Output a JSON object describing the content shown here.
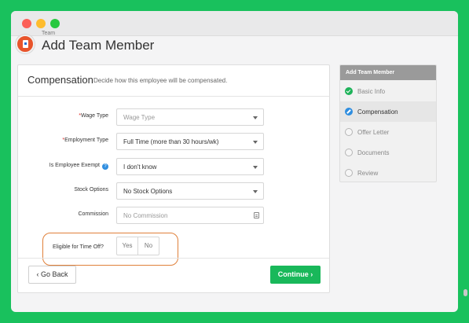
{
  "header": {
    "subtitle": "Team",
    "title": "Add Team Member"
  },
  "card": {
    "title": "Compensation",
    "description": "Decide how this employee will be compensated."
  },
  "fields": {
    "wage_type": {
      "label": "Wage Type",
      "required": "*",
      "placeholder": "Wage Type"
    },
    "employment_type": {
      "label": "Employment Type",
      "required": "*",
      "value": "Full Time (more than 30 hours/wk)"
    },
    "exempt": {
      "label": "Is Employee Exempt",
      "help": "?",
      "value": "I don't know"
    },
    "stock_options": {
      "label": "Stock Options",
      "value": "No Stock Options"
    },
    "commission": {
      "label": "Commission",
      "placeholder": "No Commission"
    },
    "time_off": {
      "label": "Eligible for Time Off?",
      "yes": "Yes",
      "no": "No"
    }
  },
  "buttons": {
    "back": "‹  Go Back",
    "continue": "Continue  ›"
  },
  "steps": {
    "title": "Add Team Member",
    "items": [
      {
        "label": "Basic Info",
        "state": "done"
      },
      {
        "label": "Compensation",
        "state": "current"
      },
      {
        "label": "Offer Letter",
        "state": "pending"
      },
      {
        "label": "Documents",
        "state": "pending"
      },
      {
        "label": "Review",
        "state": "pending"
      }
    ]
  },
  "colors": {
    "background": "#19c15d",
    "primary": "#19b85a",
    "highlight": "#e0803a",
    "info": "#2f8ee0",
    "required": "#e0332d"
  },
  "icons": [
    "company-logo-icon",
    "help-icon",
    "chevron-down-icon",
    "calculator-icon",
    "check-circle-icon",
    "pencil-circle-icon",
    "empty-circle-icon"
  ]
}
